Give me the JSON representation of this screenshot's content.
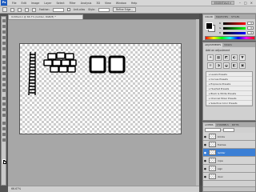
{
  "app": {
    "logo": "Ps"
  },
  "menu": [
    "File",
    "Edit",
    "Image",
    "Layer",
    "Select",
    "Filter",
    "Analysis",
    "3D",
    "View",
    "Window",
    "Help"
  ],
  "workspace_label": "ESSENTIALS ▾",
  "window_controls": [
    "–",
    "□",
    "×"
  ],
  "options": {
    "feather_label": "Feather:",
    "anti_alias_label": "Anti-alias",
    "style_label": "Style:",
    "refine_label": "Refine Edge..."
  },
  "document": {
    "tab_title": "Untitled-1 @ 66.7% (ladder, RGB/8) *",
    "status": "66.67%"
  },
  "panels": {
    "color_tabs": [
      "COLOR",
      "SWATCHES",
      "STYLES"
    ],
    "adjustments_tabs": [
      "ADJUSTMENTS",
      "MASKS"
    ],
    "adjustments_header": "Add an adjustment",
    "adjustment_icons": [
      "☀",
      "▦",
      "◩",
      "◐",
      "▼",
      "≡",
      "◑",
      "◒",
      "◧",
      "▣"
    ],
    "presets": [
      "Levels Presets",
      "Curves Presets",
      "Exposure Presets",
      "Hue/Sat Presets",
      "Black & White Presets",
      "Channel Mixer Presets",
      "Selective Color Presets"
    ],
    "layers_tabs": [
      "LAYERS",
      "CHANNELS",
      "PATHS"
    ],
    "layers": [
      {
        "name": "bricks",
        "selected": false
      },
      {
        "name": "frames",
        "selected": false
      },
      {
        "name": "ladder",
        "selected": true
      },
      {
        "name": "rope",
        "selected": false
      },
      {
        "name": "sign",
        "selected": false
      },
      {
        "name": "door",
        "selected": false
      }
    ]
  },
  "colors": {
    "accent": "#3b7fd5",
    "canvas_bg": "#a7a7a7",
    "ui_dark": "#535353"
  }
}
